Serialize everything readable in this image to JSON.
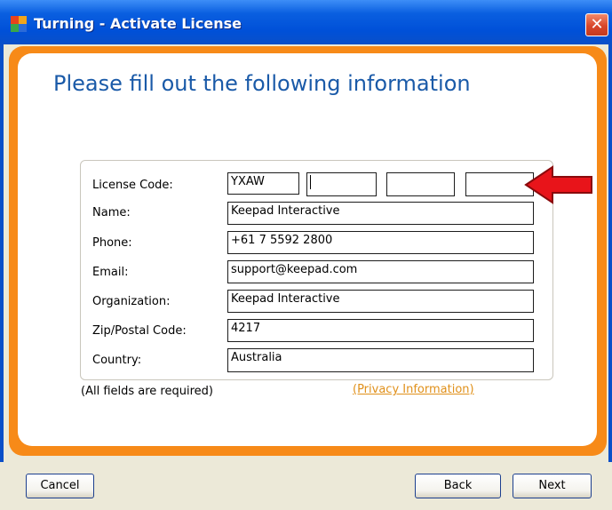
{
  "window": {
    "title": "Turning - Activate License",
    "close_symbol": "✕"
  },
  "main": {
    "heading": "Please fill out the following information"
  },
  "form": {
    "license_code": {
      "label": "License Code:",
      "segments": [
        "YXAW",
        "",
        "",
        ""
      ]
    },
    "name": {
      "label": "Name:",
      "value": "Keepad Interactive"
    },
    "phone": {
      "label": "Phone:",
      "value": "+61 7 5592 2800"
    },
    "email": {
      "label": "Email:",
      "value": "support@keepad.com"
    },
    "organization": {
      "label": "Organization:",
      "value": "Keepad Interactive"
    },
    "zip": {
      "label": "Zip/Postal Code:",
      "value": "4217"
    },
    "country": {
      "label": "Country:",
      "value": "Australia"
    },
    "required_note": "(All fields are required)",
    "privacy_link": "(Privacy Information)"
  },
  "buttons": {
    "cancel": "Cancel",
    "back": "Back",
    "next": "Next"
  },
  "colors": {
    "title_bar": "#0050d8",
    "frame_accent": "#f78a18",
    "heading": "#1a5aa8",
    "link": "#e0901a",
    "arrow": "#e8141a"
  }
}
